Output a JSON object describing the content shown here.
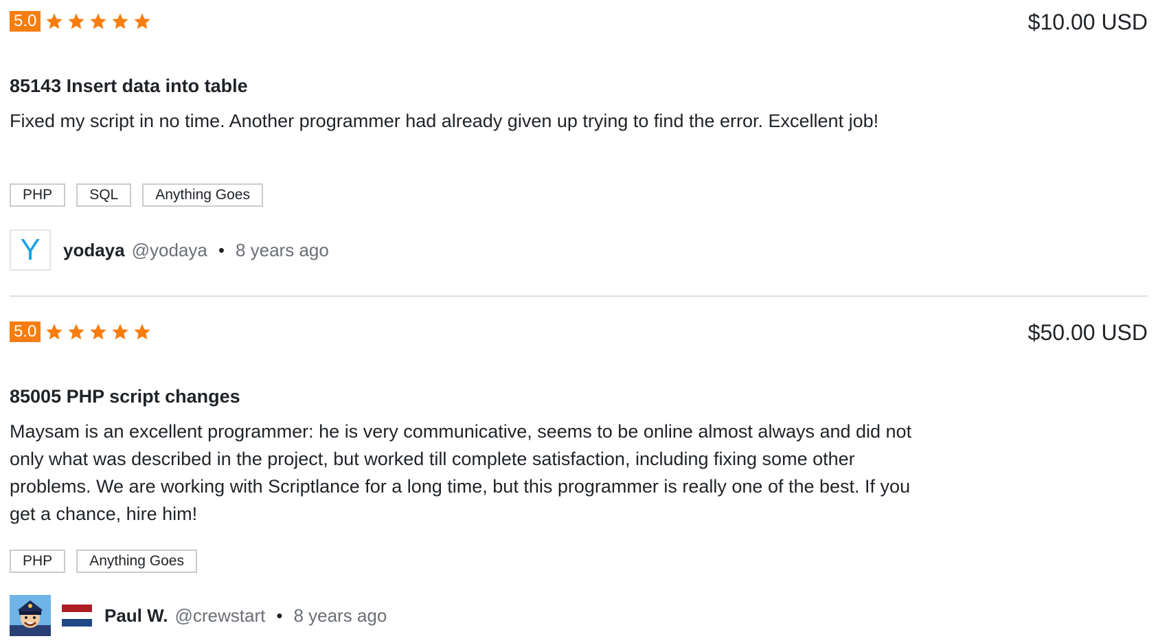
{
  "colors": {
    "accent": "#f77d0e",
    "avatar_letter": "#1da1e6",
    "text": "#1f2327",
    "muted": "#6b6f75"
  },
  "reviews": [
    {
      "rating": "5.0",
      "stars": 5,
      "amount": "$10.00 USD",
      "title": "85143 Insert data into table",
      "comment": "Fixed my script in no time. Another programmer had already given up trying to find the error. Excellent job!",
      "tags": [
        "PHP",
        "SQL",
        "Anything Goes"
      ],
      "avatar_letter": "Y",
      "name": "yodaya",
      "handle": "@yodaya",
      "separator": "•",
      "time": "8 years ago"
    },
    {
      "rating": "5.0",
      "stars": 5,
      "amount": "$50.00 USD",
      "title": "85005 PHP script changes",
      "comment": "Maysam is an excellent programmer: he is very communicative, seems to be online almost always and did not only what was described in the project, but worked till complete satisfaction, including fixing some other problems. We are working with Scriptlance for a long time, but this programmer is really one of the best. If you get a chance, hire him!",
      "tags": [
        "PHP",
        "Anything Goes"
      ],
      "flag": "netherlands-flag",
      "name": "Paul W.",
      "handle": "@crewstart",
      "separator": "•",
      "time": "8 years ago"
    }
  ]
}
